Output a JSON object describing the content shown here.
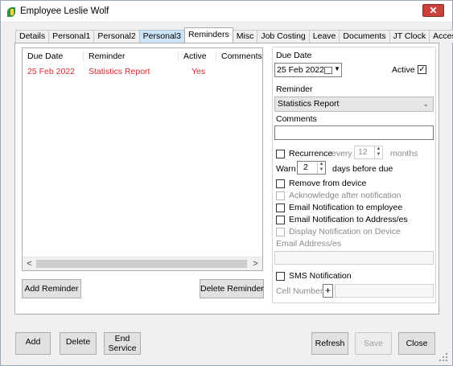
{
  "window": {
    "title": "Employee Leslie Wolf"
  },
  "tabs": [
    {
      "label": "Details"
    },
    {
      "label": "Personal1"
    },
    {
      "label": "Personal2"
    },
    {
      "label": "Personal3"
    },
    {
      "label": "Reminders"
    },
    {
      "label": "Misc"
    },
    {
      "label": "Job Costing"
    },
    {
      "label": "Leave"
    },
    {
      "label": "Documents"
    },
    {
      "label": "JT Clock"
    },
    {
      "label": "Access"
    }
  ],
  "list": {
    "columns": [
      "Due Date",
      "Reminder",
      "Active",
      "Comments"
    ],
    "rows": [
      {
        "due_date": "25 Feb 2022",
        "reminder": "Statistics Report",
        "active": "Yes",
        "comments": ""
      }
    ]
  },
  "buttons": {
    "add_reminder": "Add Reminder",
    "delete_reminder": "Delete Reminder"
  },
  "form": {
    "due_date_label": "Due Date",
    "due_date_value": "25 Feb 2022",
    "active_label": "Active",
    "active_checked": true,
    "reminder_label": "Reminder",
    "reminder_value": "Statistics Report",
    "comments_label": "Comments",
    "comments_value": "",
    "recurrence_label": "Recurrence",
    "every_label": "every",
    "every_value": "12",
    "months_label": "months",
    "warn_label": "Warn",
    "warn_value": "2",
    "days_before_label": "days before due",
    "remove_from_device": "Remove from device",
    "acknowledge_after": "Acknowledge after notification",
    "email_to_employee": "Email Notification to employee",
    "email_to_address": "Email Notification to Address/es",
    "display_on_device": "Display Notification on Device",
    "email_address_label": "Email Address/es",
    "sms_label": "SMS Notification",
    "cell_label": "Cell Number/s",
    "cell_add": "+"
  },
  "footer": {
    "add": "Add",
    "delete": "Delete",
    "end_service": "End Service",
    "refresh": "Refresh",
    "save": "Save",
    "close": "Close"
  }
}
